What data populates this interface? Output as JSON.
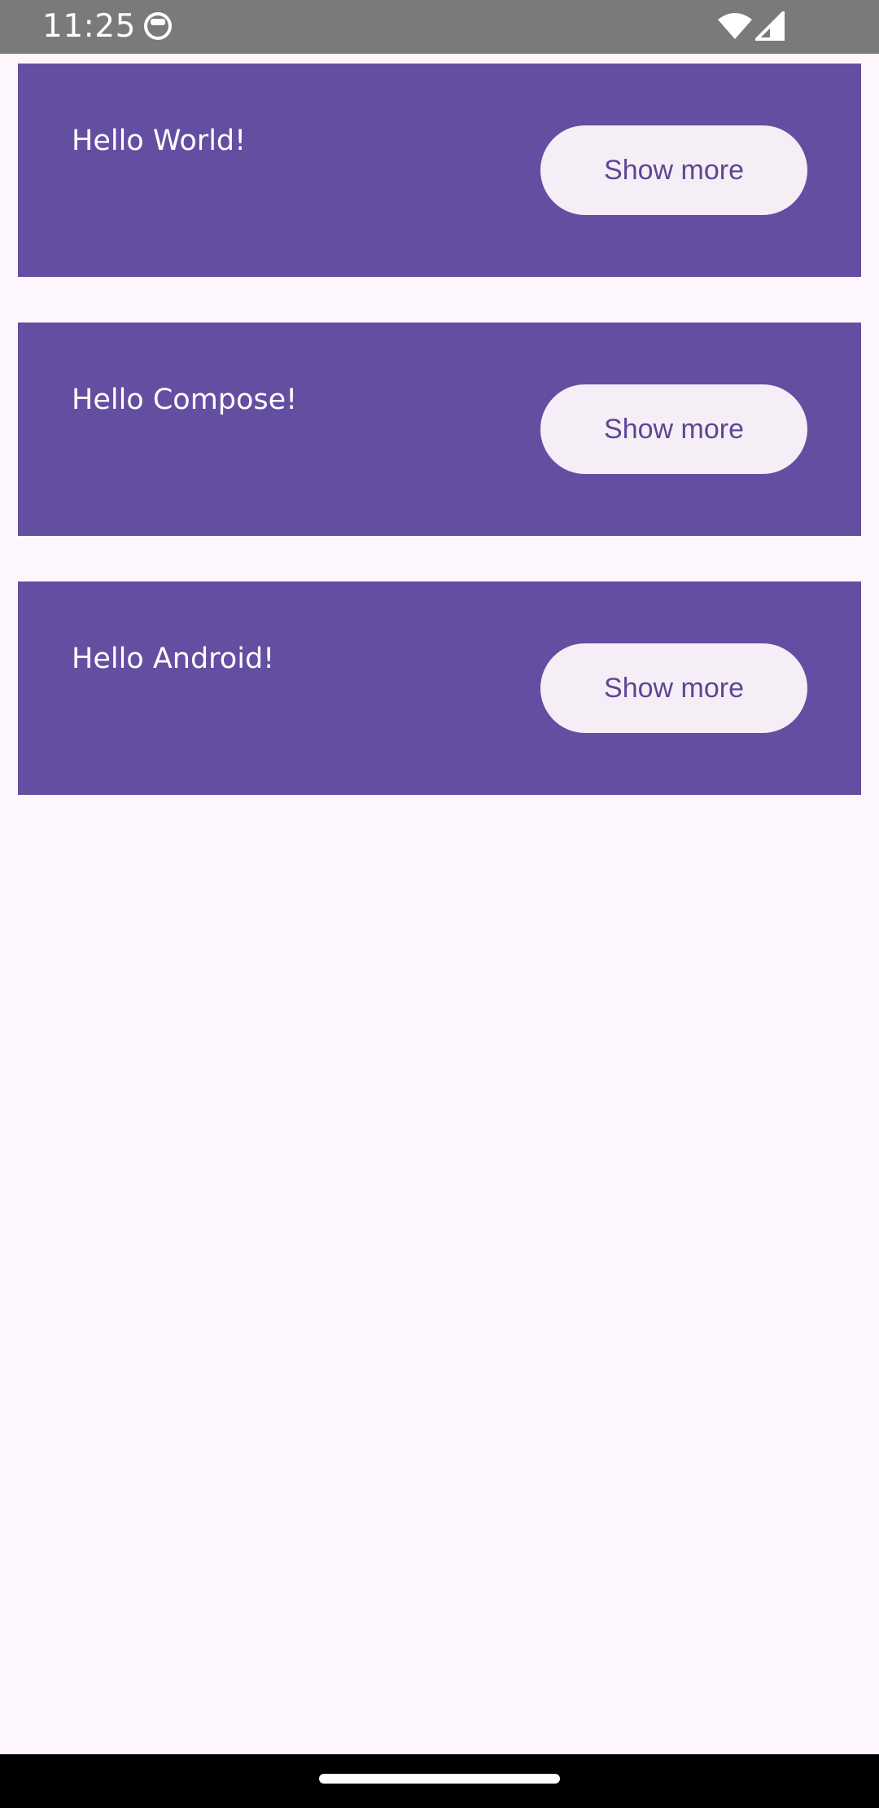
{
  "status_bar": {
    "time": "11:25",
    "app_icon": "app-notification-icon",
    "wifi_icon": "wifi-icon",
    "signal_icon": "cell-signal-icon"
  },
  "cards": [
    {
      "title": "Hello World!",
      "button_label": "Show more"
    },
    {
      "title": "Hello Compose!",
      "button_label": "Show more"
    },
    {
      "title": "Hello Android!",
      "button_label": "Show more"
    }
  ],
  "colors": {
    "background": "#fdf7fd",
    "card": "#644ea1",
    "button_bg": "#f6eef6",
    "button_text": "#5b4793",
    "status_bar": "#7a7a7a",
    "nav_bar": "#000000"
  },
  "nav_bar": {
    "home_indicator": "home-gesture-handle"
  }
}
